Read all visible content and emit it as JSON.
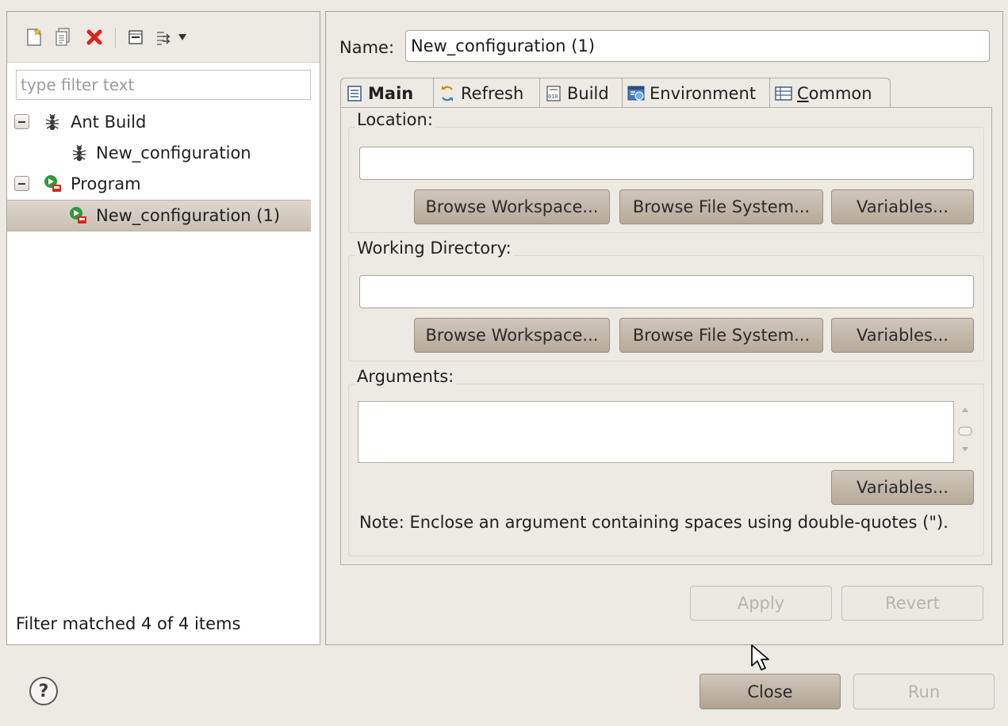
{
  "left_panel": {
    "filter_placeholder": "type filter text",
    "filter_value": "",
    "tree": [
      {
        "label": "Ant Build",
        "icon": "ant-icon",
        "expanded": true,
        "level": 0
      },
      {
        "label": "New_configuration",
        "icon": "ant-icon",
        "level": 1
      },
      {
        "label": "Program",
        "icon": "program-launch-icon",
        "expanded": true,
        "level": 0
      },
      {
        "label": "New_configuration (1)",
        "icon": "program-launch-icon",
        "level": 1,
        "selected": true
      }
    ],
    "status": "Filter matched 4 of 4 items"
  },
  "toolbar": {
    "icons": [
      "new-configuration-icon",
      "duplicate-icon",
      "delete-icon",
      "collapse-all-icon",
      "filter-menu-icon"
    ]
  },
  "config": {
    "name_label": "Name:",
    "name_value": "New_configuration (1)"
  },
  "tabs": [
    {
      "label": "Main",
      "icon": "main-tab-icon",
      "active": true
    },
    {
      "label": "Refresh",
      "icon": "refresh-icon"
    },
    {
      "label": "Build",
      "icon": "build-icon"
    },
    {
      "label": "Environment",
      "icon": "environment-icon"
    },
    {
      "label": "Common",
      "icon": "common-icon",
      "mnemonic": "C"
    }
  ],
  "main_tab": {
    "location": {
      "title": "Location:",
      "value": "",
      "buttons": [
        "Browse Workspace...",
        "Browse File System...",
        "Variables..."
      ]
    },
    "working_directory": {
      "title": "Working Directory:",
      "value": "",
      "buttons": [
        "Browse Workspace...",
        "Browse File System...",
        "Variables..."
      ]
    },
    "arguments": {
      "title": "Arguments:",
      "value": "",
      "button": "Variables...",
      "note": "Note: Enclose an argument containing spaces using double-quotes (\")."
    }
  },
  "actions": {
    "apply": "Apply",
    "revert": "Revert",
    "close": "Close",
    "run": "Run"
  },
  "colors": {
    "background": "#ede9e3",
    "selection": "#c9c0b3",
    "button": "#b6aa99",
    "delete_red": "#d8261c",
    "run_green": "#2e9a3a"
  }
}
